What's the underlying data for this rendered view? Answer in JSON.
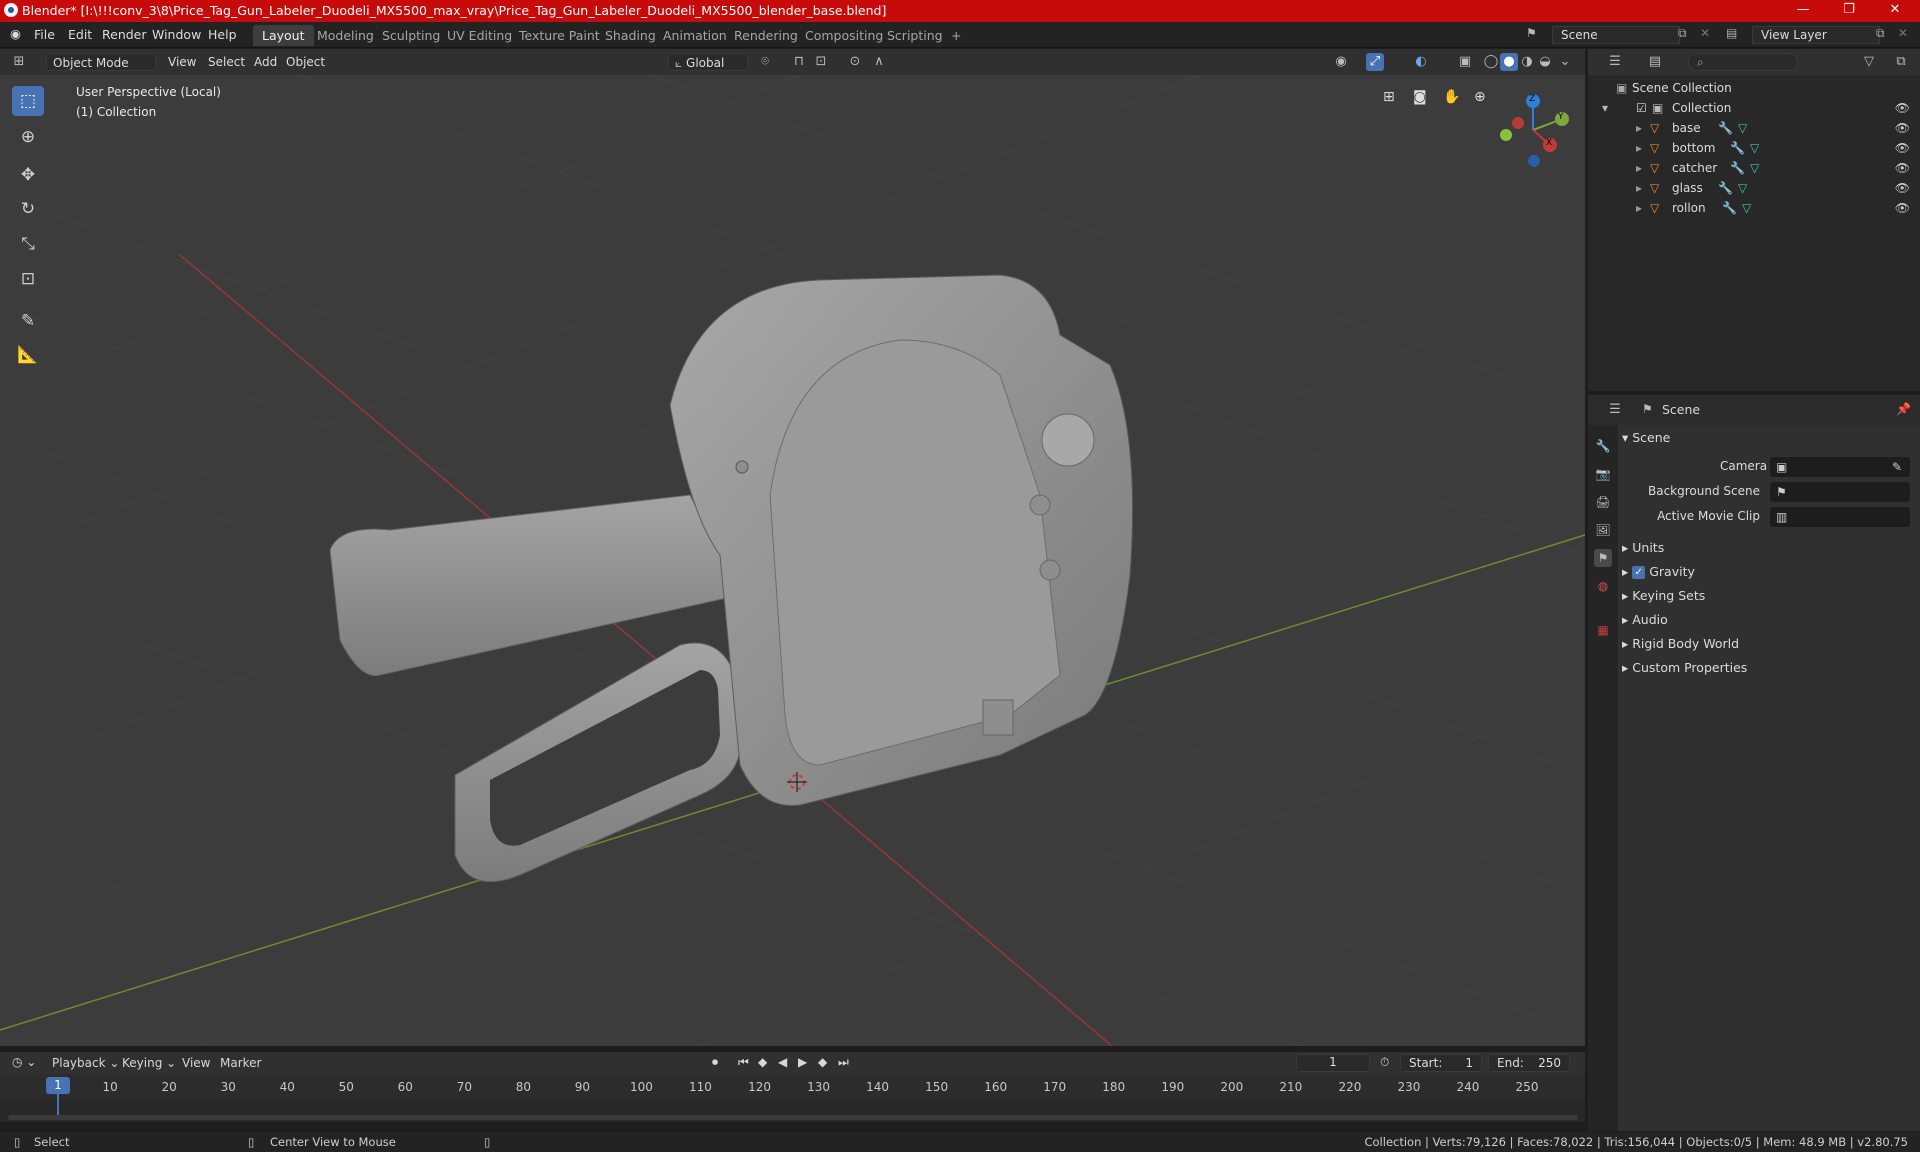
{
  "window": {
    "title": "Blender* [I:\\!!!conv_3\\8\\Price_Tag_Gun_Labeler_Duodeli_MX5500_max_vray\\Price_Tag_Gun_Labeler_Duodeli_MX5500_blender_base.blend]",
    "minimize": "—",
    "maximize": "❐",
    "close": "✕"
  },
  "menu": {
    "file": "File",
    "edit": "Edit",
    "render": "Render",
    "window": "Window",
    "help": "Help"
  },
  "workspaces": [
    "Layout",
    "Modeling",
    "Sculpting",
    "UV Editing",
    "Texture Paint",
    "Shading",
    "Animation",
    "Rendering",
    "Compositing",
    "Scripting",
    "+"
  ],
  "scene_selector": {
    "label": "Scene"
  },
  "viewlayer_selector": {
    "label": "View Layer"
  },
  "viewport_header": {
    "mode": "Object Mode",
    "view": "View",
    "select": "Select",
    "add": "Add",
    "object": "Object",
    "orientation": "Global"
  },
  "viewport": {
    "perspective": "User Perspective (Local)",
    "collection": "(1) Collection",
    "gizmo": {
      "z": "Z",
      "y": "Y",
      "x": "X"
    }
  },
  "outliner": {
    "root": "Scene Collection",
    "collection": "Collection",
    "objects": [
      "base",
      "bottom",
      "catcher",
      "glass",
      "rollon"
    ]
  },
  "properties": {
    "header": "Scene",
    "panel": "Scene",
    "camera_label": "Camera",
    "background_scene_label": "Background Scene",
    "active_movie_clip_label": "Active Movie Clip",
    "sections": [
      "Units",
      "Gravity",
      "Keying Sets",
      "Audio",
      "Rigid Body World",
      "Custom Properties"
    ],
    "gravity_checked": true
  },
  "timeline": {
    "playback": "Playback",
    "keying": "Keying",
    "view": "View",
    "marker": "Marker",
    "current_frame": "1",
    "start_label": "Start:",
    "start": "1",
    "end_label": "End:",
    "end": "250",
    "ticks": [
      "10",
      "20",
      "30",
      "40",
      "50",
      "60",
      "70",
      "80",
      "90",
      "100",
      "110",
      "120",
      "130",
      "140",
      "150",
      "160",
      "170",
      "180",
      "190",
      "200",
      "210",
      "220",
      "230",
      "240",
      "250"
    ],
    "cursor": "1"
  },
  "statusbar": {
    "select": "Select",
    "center_view": "Center View to Mouse",
    "stats": "Collection | Verts:79,126 | Faces:78,022 | Tris:156,044 | Objects:0/5 | Mem: 48.9 MB | v2.80.75"
  },
  "colors": {
    "title_bar": "#c70a0a",
    "accent": "#4772b3",
    "x_axis": "#c0393b",
    "y_axis": "#7fa83a",
    "z_axis": "#2f7fd8"
  }
}
